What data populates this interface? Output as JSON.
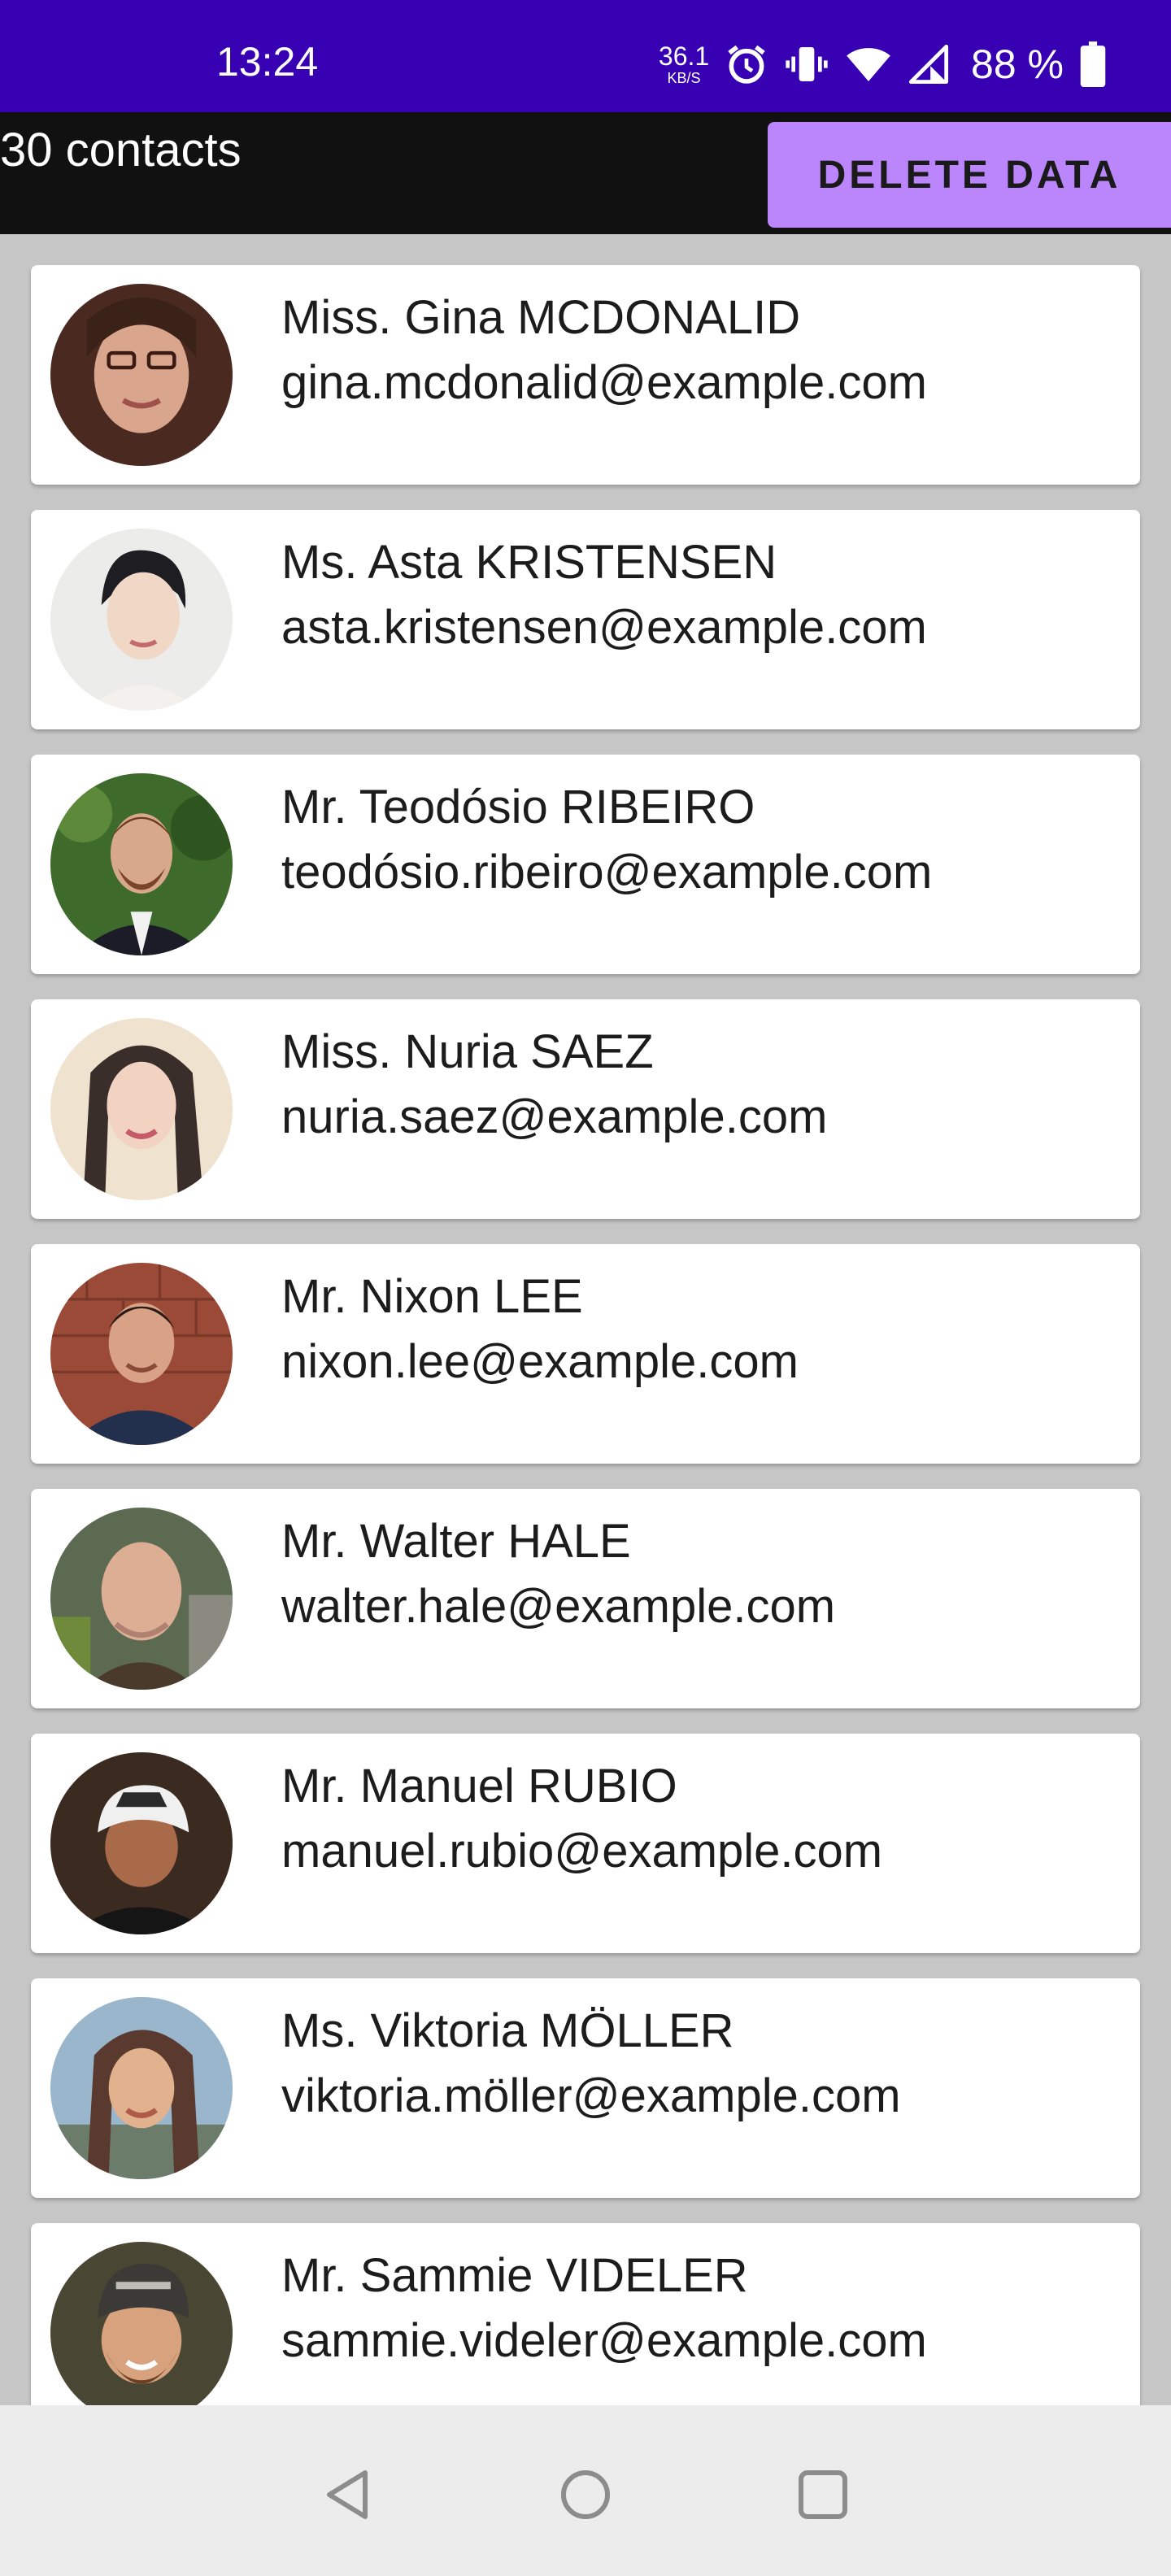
{
  "status_bar": {
    "time": "13:24",
    "net_speed_value": "36.1",
    "net_speed_unit": "KB/S",
    "battery_text": "88 %",
    "icons": [
      "alarm-icon",
      "vibrate-icon",
      "wifi-icon",
      "signal-icon",
      "battery-icon"
    ]
  },
  "toolbar": {
    "contact_count": "30 contacts",
    "delete_label": "DELETE DATA"
  },
  "colors": {
    "status_bar": "#3700b3",
    "toolbar": "#111111",
    "accent": "#bb86fc",
    "list_background": "#c6c6c6",
    "card": "#ffffff"
  },
  "contacts": [
    {
      "name": "Miss. Gina MCDONALID",
      "email": "gina.mcdonalid@example.com"
    },
    {
      "name": "Ms. Asta KRISTENSEN",
      "email": "asta.kristensen@example.com"
    },
    {
      "name": "Mr. Teodósio RIBEIRO",
      "email": "teodósio.ribeiro@example.com"
    },
    {
      "name": "Miss. Nuria SAEZ",
      "email": "nuria.saez@example.com"
    },
    {
      "name": "Mr. Nixon LEE",
      "email": "nixon.lee@example.com"
    },
    {
      "name": "Mr. Walter HALE",
      "email": "walter.hale@example.com"
    },
    {
      "name": "Mr. Manuel RUBIO",
      "email": "manuel.rubio@example.com"
    },
    {
      "name": "Ms. Viktoria MÖLLER",
      "email": "viktoria.möller@example.com"
    },
    {
      "name": "Mr. Sammie VIDELER",
      "email": "sammie.videler@example.com"
    }
  ],
  "nav_bar": {
    "icons": [
      "back-icon",
      "home-icon",
      "recents-icon"
    ]
  }
}
